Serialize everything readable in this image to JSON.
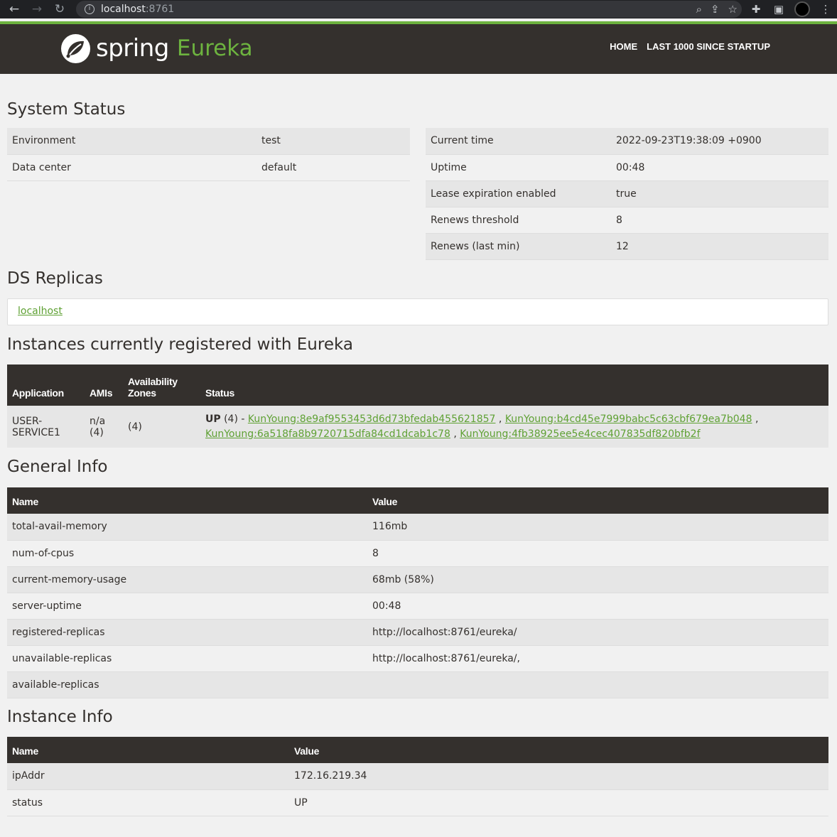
{
  "browser": {
    "url_host": "localhost",
    "url_port": ":8761"
  },
  "navbar": {
    "brand_spring": "spring",
    "brand_eureka": "Eureka",
    "links": [
      "HOME",
      "LAST 1000 SINCE STARTUP"
    ]
  },
  "system_status": {
    "title": "System Status",
    "left": [
      {
        "label": "Environment",
        "value": "test"
      },
      {
        "label": "Data center",
        "value": "default"
      }
    ],
    "right": [
      {
        "label": "Current time",
        "value": "2022-09-23T19:38:09 +0900"
      },
      {
        "label": "Uptime",
        "value": "00:48"
      },
      {
        "label": "Lease expiration enabled",
        "value": "true"
      },
      {
        "label": "Renews threshold",
        "value": "8"
      },
      {
        "label": "Renews (last min)",
        "value": "12"
      }
    ]
  },
  "ds_replicas": {
    "title": "DS Replicas",
    "link": "localhost"
  },
  "instances": {
    "title": "Instances currently registered with Eureka",
    "headers": {
      "application": "Application",
      "amis": "AMIs",
      "zones": "Availability Zones",
      "status": "Status"
    },
    "rows": [
      {
        "application": "USER-SERVICE1",
        "amis": "n/a (4)",
        "zones": "(4)",
        "status_prefix": "UP",
        "status_count": " (4) - ",
        "instance_links": [
          "KunYoung:8e9af9553453d6d73bfedab455621857",
          "KunYoung:b4cd45e7999babc5c63cbf679ea7b048",
          "KunYoung:6a518fa8b9720715dfa84cd1dcab1c78",
          "KunYoung:4fb38925ee5e4cec407835df820bfb2f"
        ]
      }
    ]
  },
  "general_info": {
    "title": "General Info",
    "headers": {
      "name": "Name",
      "value": "Value"
    },
    "rows": [
      {
        "name": "total-avail-memory",
        "value": "116mb"
      },
      {
        "name": "num-of-cpus",
        "value": "8"
      },
      {
        "name": "current-memory-usage",
        "value": "68mb (58%)"
      },
      {
        "name": "server-uptime",
        "value": "00:48"
      },
      {
        "name": "registered-replicas",
        "value": "http://localhost:8761/eureka/"
      },
      {
        "name": "unavailable-replicas",
        "value": "http://localhost:8761/eureka/,"
      },
      {
        "name": "available-replicas",
        "value": ""
      }
    ]
  },
  "instance_info": {
    "title": "Instance Info",
    "headers": {
      "name": "Name",
      "value": "Value"
    },
    "rows": [
      {
        "name": "ipAddr",
        "value": "172.16.219.34"
      },
      {
        "name": "status",
        "value": "UP"
      }
    ]
  },
  "colors": {
    "navbar_bg": "#34302d",
    "accent_green": "#6db33f",
    "link_green": "#5fa134",
    "page_bg": "#f1f1f1"
  }
}
